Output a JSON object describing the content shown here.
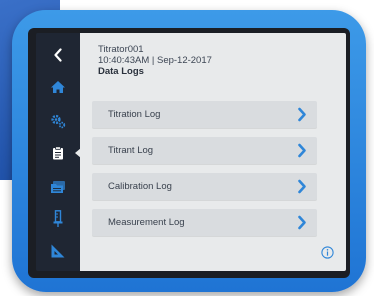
{
  "header": {
    "device_name": "Titrator001",
    "timestamp": "10:40:43AM | Sep-12-2017",
    "title": "Data Logs"
  },
  "menu": [
    {
      "label": "Titration Log",
      "icon": "chevron-right-icon"
    },
    {
      "label": "Titrant Log",
      "icon": "chevron-right-icon"
    },
    {
      "label": "Calibration Log",
      "icon": "chevron-right-icon"
    },
    {
      "label": "Measurement Log",
      "icon": "chevron-right-icon"
    }
  ],
  "sidebar": {
    "items": [
      {
        "name": "back",
        "icon": "chevron-left-icon"
      },
      {
        "name": "home",
        "icon": "home-icon"
      },
      {
        "name": "settings",
        "icon": "gears-icon"
      },
      {
        "name": "data-logs",
        "icon": "clipboard-icon",
        "active": true
      },
      {
        "name": "files",
        "icon": "folders-icon"
      },
      {
        "name": "burette",
        "icon": "burette-icon"
      },
      {
        "name": "calibration",
        "icon": "ruler-triangle-icon"
      }
    ]
  },
  "colors": {
    "accent": "#2f86d8",
    "sidebar_bg": "#1f2633",
    "content_bg": "#e8eaeb",
    "button_bg": "#d9dcdf",
    "device_shell": "#2d88de"
  }
}
